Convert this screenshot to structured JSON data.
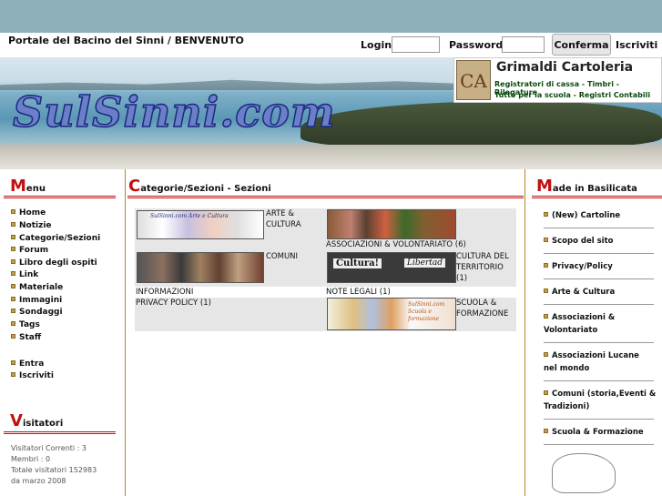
{
  "header": {
    "site_title": "Portale del Bacino del Sinni / BENVENUTO",
    "login_label": "Login",
    "password_label": "Password",
    "confirm_label": "Conferma",
    "register_label": "Iscriviti"
  },
  "banner": {
    "logo_text": "SulSinni.com",
    "ad": {
      "logo_mark": "CA",
      "title": "Grimaldi Cartoleria",
      "line1": "Registratori di cassa - Timbri - Rilegature",
      "line2": "Tutto per la scuola - Registri Contabili"
    }
  },
  "menu": {
    "cap": "M",
    "rest": "enu",
    "items": [
      "Home",
      "Notizie",
      "Categorie/Sezioni",
      "Forum",
      "Libro degli ospiti",
      "Link",
      "Materiale",
      "Immagini",
      "Sondaggi",
      "Tags",
      "Staff"
    ],
    "account_items": [
      "Entra",
      "Iscriviti"
    ]
  },
  "visitors": {
    "cap": "V",
    "rest": "isitatori",
    "current": "Visitatori Correnti : 3",
    "members": "Membri : 0",
    "total": "Totale visitatori 152983",
    "since": "da marzo 2008"
  },
  "main": {
    "cap": "C",
    "rest": "ategorie/Sezioni - Sezioni",
    "categories": [
      {
        "label_a": "ARTE &",
        "label_b": "CULTURA"
      },
      {
        "label": "ASSOCIAZIONI & VOLONTARIATO (6)"
      },
      {
        "label": "COMUNI"
      },
      {
        "label_a": "CULTURA DEL",
        "label_b": "TERRITORIO",
        "label_c": "(1)"
      },
      {
        "label": "INFORMAZIONI"
      },
      {
        "label": "NOTE LEGALI (1)"
      },
      {
        "label": "PRIVACY POLICY (1)"
      },
      {
        "label_a": "SCUOLA &",
        "label_b": "FORMAZIONE"
      }
    ],
    "thumb_texts": {
      "arte": "SulSinni.com Arte e Cultura",
      "cultura_a": "Cultura!",
      "cultura_b": "Libertad",
      "scuola": "SulSinni.com Scuola e formazione"
    }
  },
  "made": {
    "cap": "M",
    "rest": "ade in Basilicata",
    "items": [
      {
        "a": "(New) Cartoline"
      },
      {
        "a": "Scopo del sito"
      },
      {
        "a": "Privacy/Policy"
      },
      {
        "a": "Arte & Cultura"
      },
      {
        "a": "Associazioni &",
        "b": "Volontariato"
      },
      {
        "a": "Associazioni Lucane",
        "b": "nel mondo"
      },
      {
        "a": "Comuni (storia,Eventi &",
        "b": "Tradizioni)"
      },
      {
        "a": "Scuola & Formazione"
      }
    ]
  },
  "colors": {
    "topbar": "#8db0ba",
    "accent_red": "#c01010",
    "column_rule": "#b8861a",
    "bullet": "#c2a24a",
    "cell_bg": "#e6e6e6"
  }
}
